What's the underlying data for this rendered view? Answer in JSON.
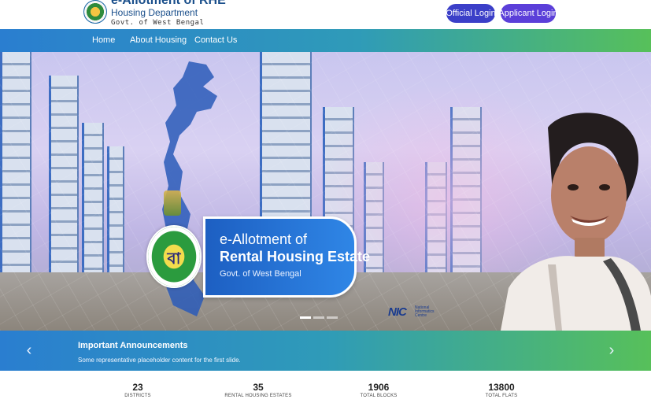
{
  "header": {
    "title": "e-Allotment of RHE",
    "department": "Housing Department",
    "govt": "Govt. of West Bengal",
    "official_login": "Official Login",
    "applicant_login": "Applicant Login"
  },
  "nav": {
    "items": [
      {
        "label": "Home"
      },
      {
        "label": "About Housing"
      },
      {
        "label": "Contact Us"
      }
    ]
  },
  "hero": {
    "line1": "e-Allotment of",
    "line2": "Rental Housing Estate",
    "line3": "Govt. of West Bengal",
    "seal_glyph": "বা",
    "nic_logo": "NIC",
    "nic_subtext": "National Informatics Centre",
    "active_slide": 1,
    "slide_count": 3
  },
  "announcement": {
    "title": "Important Announcements",
    "text": "Some representative placeholder content for the first slide.",
    "prev_icon": "chevron-left-icon",
    "next_icon": "chevron-right-icon"
  },
  "stats": [
    {
      "value": "23",
      "label": "DISTRICTS"
    },
    {
      "value": "35",
      "label": "RENTAL HOUSING ESTATES"
    },
    {
      "value": "1906",
      "label": "TOTAL BLOCKS"
    },
    {
      "value": "13800",
      "label": "TOTAL FLATS"
    }
  ],
  "colors": {
    "brand_blue": "#1a4f8b",
    "nav_start": "#2a7ed0",
    "nav_end": "#57c05a",
    "official_btn": "#3b3fc8",
    "applicant_btn": "#5b3fd9",
    "hero_card": "#2f86e6"
  }
}
